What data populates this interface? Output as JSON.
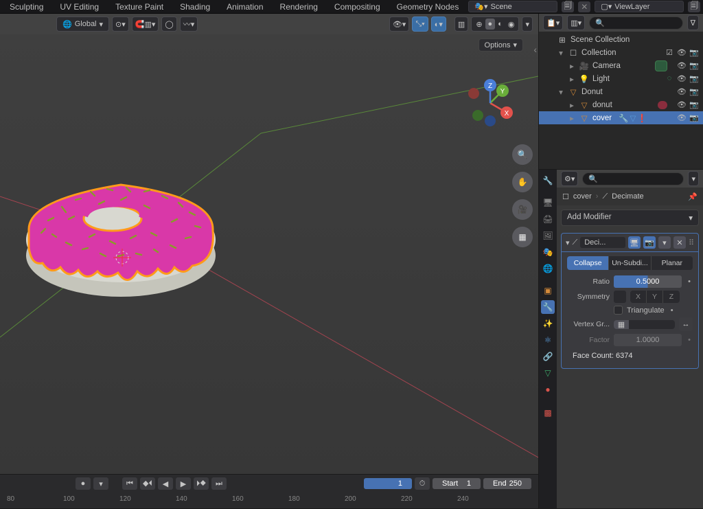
{
  "topbar": {
    "tabs": [
      "Sculpting",
      "UV Editing",
      "Texture Paint",
      "Shading",
      "Animation",
      "Rendering",
      "Compositing",
      "Geometry Nodes"
    ],
    "scene": "Scene",
    "viewlayer": "ViewLayer"
  },
  "viewport": {
    "orientation": "Global",
    "options": "Options"
  },
  "gizmo": {
    "x": "X",
    "y": "Y",
    "z": "Z"
  },
  "outliner": {
    "search_placeholder": "",
    "rows": [
      {
        "indent": 0,
        "expander": "",
        "icon_class": "box",
        "icon": "⊞",
        "label": "Scene Collection"
      },
      {
        "indent": 1,
        "expander": "▾",
        "icon_class": "box",
        "icon": "☐",
        "label": "Collection",
        "checkbox": true,
        "trail": [
          "👁",
          "📷"
        ]
      },
      {
        "indent": 2,
        "expander": "▸",
        "icon_class": "cam",
        "icon": "🎥",
        "label": "Camera",
        "swatch": "green",
        "trail": [
          "👁",
          "📷"
        ]
      },
      {
        "indent": 2,
        "expander": "▸",
        "icon_class": "light",
        "icon": "💡",
        "label": "Light",
        "trailcolor": "#3daa6a",
        "trail": [
          "◌",
          "👁",
          "📷"
        ]
      },
      {
        "indent": 1,
        "expander": "▾",
        "icon_class": "mesh",
        "icon": "▽",
        "label": "Donut",
        "trail": [
          "👁",
          "📷"
        ]
      },
      {
        "indent": 2,
        "expander": "▸",
        "icon_class": "mesh",
        "icon": "▽",
        "label": "donut",
        "swatch": "red",
        "trail": [
          "👁",
          "📷"
        ]
      },
      {
        "indent": 2,
        "expander": "▸",
        "icon_class": "mesh",
        "icon": "▽",
        "label": "cover",
        "selected": true,
        "modicons": true,
        "trail": [
          "👁",
          "📷"
        ]
      }
    ]
  },
  "timeline": {
    "current": "1",
    "start_label": "Start",
    "start": "1",
    "end_label": "End",
    "end": "250",
    "ruler": [
      "80",
      "100",
      "120",
      "140",
      "160",
      "180",
      "200",
      "220",
      "240"
    ]
  },
  "props": {
    "breadcrumb": {
      "obj_icon": "☐",
      "obj": "cover",
      "mod_icon": "⟋",
      "mod": "Decimate"
    },
    "add_modifier": "Add Modifier",
    "modifier": {
      "name": "Deci...",
      "modes": {
        "collapse": "Collapse",
        "unsubdiv": "Un-Subdi...",
        "planar": "Planar"
      },
      "ratio_label": "Ratio",
      "ratio": "0.5000",
      "symmetry_label": "Symmetry",
      "axes": [
        "X",
        "Y",
        "Z"
      ],
      "triangulate": "Triangulate",
      "vg_label": "Vertex Gr...",
      "factor_label": "Factor",
      "factor": "1.0000",
      "face_count": "Face Count: 6374"
    }
  }
}
